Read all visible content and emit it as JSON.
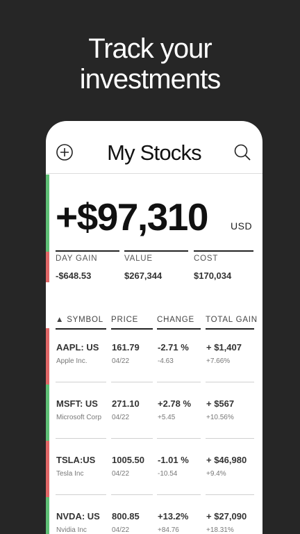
{
  "promo": {
    "line1": "Track your",
    "line2": "investments"
  },
  "app": {
    "title": "My Stocks"
  },
  "portfolio": {
    "total": "+$97,310",
    "currency": "USD",
    "summary": [
      {
        "label": "DAY GAIN",
        "value": "-$648.53"
      },
      {
        "label": "VALUE",
        "value": "$267,344"
      },
      {
        "label": "COST",
        "value": "$170,034"
      }
    ]
  },
  "table": {
    "sort_indicator": "▲",
    "headers": [
      "SYMBOL",
      "PRICE",
      "CHANGE",
      "TOTAL GAIN"
    ],
    "rows": [
      {
        "symbol": "AAPL: US",
        "name": "Apple Inc.",
        "price": "161.79",
        "date": "04/22",
        "change_pct": "-2.71 %",
        "change_abs": "-4.63",
        "gain": "+ $1,407",
        "gain_pct": "+7.66%",
        "status": "down"
      },
      {
        "symbol": "MSFT: US",
        "name": "Microsoft Corp",
        "price": "271.10",
        "date": "04/22",
        "change_pct": "+2.78 %",
        "change_abs": "+5.45",
        "gain": "+ $567",
        "gain_pct": "+10.56%",
        "status": "up"
      },
      {
        "symbol": "TSLA:US",
        "name": "Tesla Inc",
        "price": "1005.50",
        "date": "04/22",
        "change_pct": "-1.01 %",
        "change_abs": "-10.54",
        "gain": "+ $46,980",
        "gain_pct": "+9.4%",
        "status": "down"
      },
      {
        "symbol": "NVDA: US",
        "name": "Nvidia Inc",
        "price": "800.85",
        "date": "04/22",
        "change_pct": "+13.2%",
        "change_abs": "+84.76",
        "gain": "+ $27,090",
        "gain_pct": "+18.31%",
        "status": "up"
      }
    ]
  },
  "colors": {
    "background": "#262626",
    "gain": "#5fbf76",
    "loss": "#e06767"
  },
  "icons": {
    "add": "plus-circle-icon",
    "search": "search-icon"
  }
}
